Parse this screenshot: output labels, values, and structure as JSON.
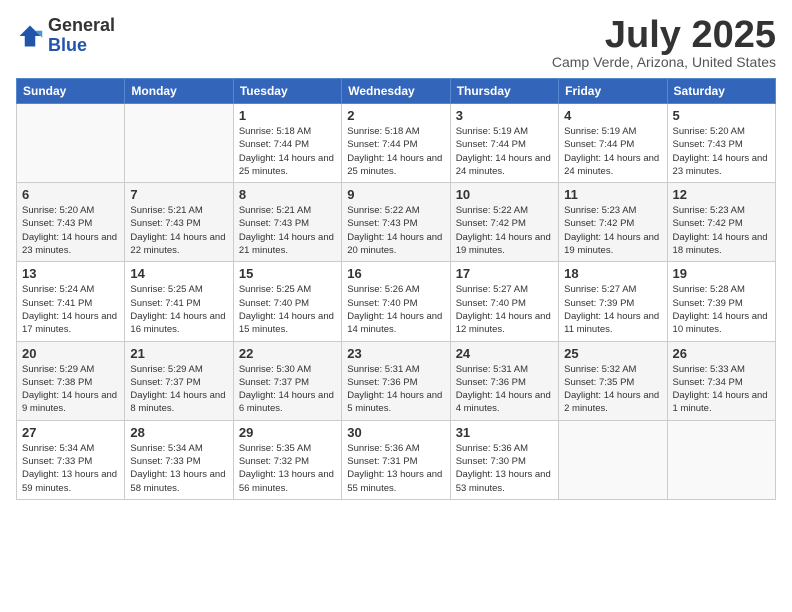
{
  "logo": {
    "general": "General",
    "blue": "Blue"
  },
  "header": {
    "month": "July 2025",
    "location": "Camp Verde, Arizona, United States"
  },
  "weekdays": [
    "Sunday",
    "Monday",
    "Tuesday",
    "Wednesday",
    "Thursday",
    "Friday",
    "Saturday"
  ],
  "weeks": [
    [
      {
        "day": "",
        "sunrise": "",
        "sunset": "",
        "daylight": ""
      },
      {
        "day": "",
        "sunrise": "",
        "sunset": "",
        "daylight": ""
      },
      {
        "day": "1",
        "sunrise": "Sunrise: 5:18 AM",
        "sunset": "Sunset: 7:44 PM",
        "daylight": "Daylight: 14 hours and 25 minutes."
      },
      {
        "day": "2",
        "sunrise": "Sunrise: 5:18 AM",
        "sunset": "Sunset: 7:44 PM",
        "daylight": "Daylight: 14 hours and 25 minutes."
      },
      {
        "day": "3",
        "sunrise": "Sunrise: 5:19 AM",
        "sunset": "Sunset: 7:44 PM",
        "daylight": "Daylight: 14 hours and 24 minutes."
      },
      {
        "day": "4",
        "sunrise": "Sunrise: 5:19 AM",
        "sunset": "Sunset: 7:44 PM",
        "daylight": "Daylight: 14 hours and 24 minutes."
      },
      {
        "day": "5",
        "sunrise": "Sunrise: 5:20 AM",
        "sunset": "Sunset: 7:43 PM",
        "daylight": "Daylight: 14 hours and 23 minutes."
      }
    ],
    [
      {
        "day": "6",
        "sunrise": "Sunrise: 5:20 AM",
        "sunset": "Sunset: 7:43 PM",
        "daylight": "Daylight: 14 hours and 23 minutes."
      },
      {
        "day": "7",
        "sunrise": "Sunrise: 5:21 AM",
        "sunset": "Sunset: 7:43 PM",
        "daylight": "Daylight: 14 hours and 22 minutes."
      },
      {
        "day": "8",
        "sunrise": "Sunrise: 5:21 AM",
        "sunset": "Sunset: 7:43 PM",
        "daylight": "Daylight: 14 hours and 21 minutes."
      },
      {
        "day": "9",
        "sunrise": "Sunrise: 5:22 AM",
        "sunset": "Sunset: 7:43 PM",
        "daylight": "Daylight: 14 hours and 20 minutes."
      },
      {
        "day": "10",
        "sunrise": "Sunrise: 5:22 AM",
        "sunset": "Sunset: 7:42 PM",
        "daylight": "Daylight: 14 hours and 19 minutes."
      },
      {
        "day": "11",
        "sunrise": "Sunrise: 5:23 AM",
        "sunset": "Sunset: 7:42 PM",
        "daylight": "Daylight: 14 hours and 19 minutes."
      },
      {
        "day": "12",
        "sunrise": "Sunrise: 5:23 AM",
        "sunset": "Sunset: 7:42 PM",
        "daylight": "Daylight: 14 hours and 18 minutes."
      }
    ],
    [
      {
        "day": "13",
        "sunrise": "Sunrise: 5:24 AM",
        "sunset": "Sunset: 7:41 PM",
        "daylight": "Daylight: 14 hours and 17 minutes."
      },
      {
        "day": "14",
        "sunrise": "Sunrise: 5:25 AM",
        "sunset": "Sunset: 7:41 PM",
        "daylight": "Daylight: 14 hours and 16 minutes."
      },
      {
        "day": "15",
        "sunrise": "Sunrise: 5:25 AM",
        "sunset": "Sunset: 7:40 PM",
        "daylight": "Daylight: 14 hours and 15 minutes."
      },
      {
        "day": "16",
        "sunrise": "Sunrise: 5:26 AM",
        "sunset": "Sunset: 7:40 PM",
        "daylight": "Daylight: 14 hours and 14 minutes."
      },
      {
        "day": "17",
        "sunrise": "Sunrise: 5:27 AM",
        "sunset": "Sunset: 7:40 PM",
        "daylight": "Daylight: 14 hours and 12 minutes."
      },
      {
        "day": "18",
        "sunrise": "Sunrise: 5:27 AM",
        "sunset": "Sunset: 7:39 PM",
        "daylight": "Daylight: 14 hours and 11 minutes."
      },
      {
        "day": "19",
        "sunrise": "Sunrise: 5:28 AM",
        "sunset": "Sunset: 7:39 PM",
        "daylight": "Daylight: 14 hours and 10 minutes."
      }
    ],
    [
      {
        "day": "20",
        "sunrise": "Sunrise: 5:29 AM",
        "sunset": "Sunset: 7:38 PM",
        "daylight": "Daylight: 14 hours and 9 minutes."
      },
      {
        "day": "21",
        "sunrise": "Sunrise: 5:29 AM",
        "sunset": "Sunset: 7:37 PM",
        "daylight": "Daylight: 14 hours and 8 minutes."
      },
      {
        "day": "22",
        "sunrise": "Sunrise: 5:30 AM",
        "sunset": "Sunset: 7:37 PM",
        "daylight": "Daylight: 14 hours and 6 minutes."
      },
      {
        "day": "23",
        "sunrise": "Sunrise: 5:31 AM",
        "sunset": "Sunset: 7:36 PM",
        "daylight": "Daylight: 14 hours and 5 minutes."
      },
      {
        "day": "24",
        "sunrise": "Sunrise: 5:31 AM",
        "sunset": "Sunset: 7:36 PM",
        "daylight": "Daylight: 14 hours and 4 minutes."
      },
      {
        "day": "25",
        "sunrise": "Sunrise: 5:32 AM",
        "sunset": "Sunset: 7:35 PM",
        "daylight": "Daylight: 14 hours and 2 minutes."
      },
      {
        "day": "26",
        "sunrise": "Sunrise: 5:33 AM",
        "sunset": "Sunset: 7:34 PM",
        "daylight": "Daylight: 14 hours and 1 minute."
      }
    ],
    [
      {
        "day": "27",
        "sunrise": "Sunrise: 5:34 AM",
        "sunset": "Sunset: 7:33 PM",
        "daylight": "Daylight: 13 hours and 59 minutes."
      },
      {
        "day": "28",
        "sunrise": "Sunrise: 5:34 AM",
        "sunset": "Sunset: 7:33 PM",
        "daylight": "Daylight: 13 hours and 58 minutes."
      },
      {
        "day": "29",
        "sunrise": "Sunrise: 5:35 AM",
        "sunset": "Sunset: 7:32 PM",
        "daylight": "Daylight: 13 hours and 56 minutes."
      },
      {
        "day": "30",
        "sunrise": "Sunrise: 5:36 AM",
        "sunset": "Sunset: 7:31 PM",
        "daylight": "Daylight: 13 hours and 55 minutes."
      },
      {
        "day": "31",
        "sunrise": "Sunrise: 5:36 AM",
        "sunset": "Sunset: 7:30 PM",
        "daylight": "Daylight: 13 hours and 53 minutes."
      },
      {
        "day": "",
        "sunrise": "",
        "sunset": "",
        "daylight": ""
      },
      {
        "day": "",
        "sunrise": "",
        "sunset": "",
        "daylight": ""
      }
    ]
  ]
}
